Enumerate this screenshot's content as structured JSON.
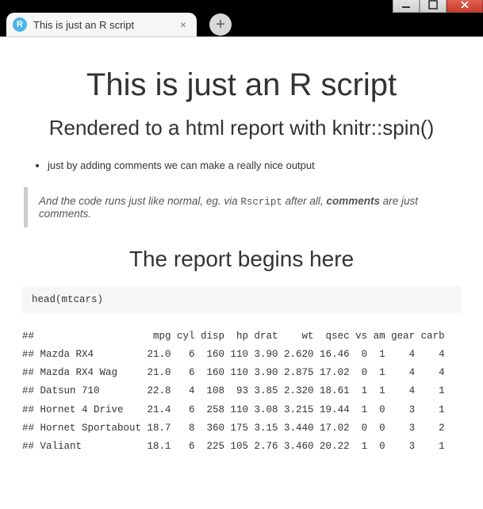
{
  "window": {
    "min_label": "min",
    "max_label": "max",
    "close_label": "close"
  },
  "tab": {
    "favicon_letter": "R",
    "title": "This is just an R script",
    "close_glyph": "×"
  },
  "newtab": {
    "glyph": "+"
  },
  "doc": {
    "h1": "This is just an R script",
    "h2": "Rendered to a html report with knitr::spin()",
    "bullet1": "just by adding comments we can make a really nice output",
    "quote_prefix": "And the code runs just like normal, eg. via ",
    "quote_code": "Rscript",
    "quote_mid": " after all, ",
    "quote_bold": "comments",
    "quote_suffix": " are just comments.",
    "section": "The report begins here",
    "code": "head(mtcars)",
    "output_header": "##                    mpg cyl disp  hp drat    wt  qsec vs am gear carb",
    "output_rows": [
      "## Mazda RX4         21.0   6  160 110 3.90 2.620 16.46  0  1    4    4",
      "## Mazda RX4 Wag     21.0   6  160 110 3.90 2.875 17.02  0  1    4    4",
      "## Datsun 710        22.8   4  108  93 3.85 2.320 18.61  1  1    4    1",
      "## Hornet 4 Drive    21.4   6  258 110 3.08 3.215 19.44  1  0    3    1",
      "## Hornet Sportabout 18.7   8  360 175 3.15 3.440 17.02  0  0    3    2",
      "## Valiant           18.1   6  225 105 2.76 3.460 20.22  1  0    3    1"
    ]
  },
  "chart_data": {
    "type": "table",
    "title": "head(mtcars)",
    "columns": [
      "",
      "mpg",
      "cyl",
      "disp",
      "hp",
      "drat",
      "wt",
      "qsec",
      "vs",
      "am",
      "gear",
      "carb"
    ],
    "rows": [
      [
        "Mazda RX4",
        21.0,
        6,
        160,
        110,
        3.9,
        2.62,
        16.46,
        0,
        1,
        4,
        4
      ],
      [
        "Mazda RX4 Wag",
        21.0,
        6,
        160,
        110,
        3.9,
        2.875,
        17.02,
        0,
        1,
        4,
        4
      ],
      [
        "Datsun 710",
        22.8,
        4,
        108,
        93,
        3.85,
        2.32,
        18.61,
        1,
        1,
        4,
        1
      ],
      [
        "Hornet 4 Drive",
        21.4,
        6,
        258,
        110,
        3.08,
        3.215,
        19.44,
        1,
        0,
        3,
        1
      ],
      [
        "Hornet Sportabout",
        18.7,
        8,
        360,
        175,
        3.15,
        3.44,
        17.02,
        0,
        0,
        3,
        2
      ],
      [
        "Valiant",
        18.1,
        6,
        225,
        105,
        2.76,
        3.46,
        20.22,
        1,
        0,
        3,
        1
      ]
    ]
  }
}
